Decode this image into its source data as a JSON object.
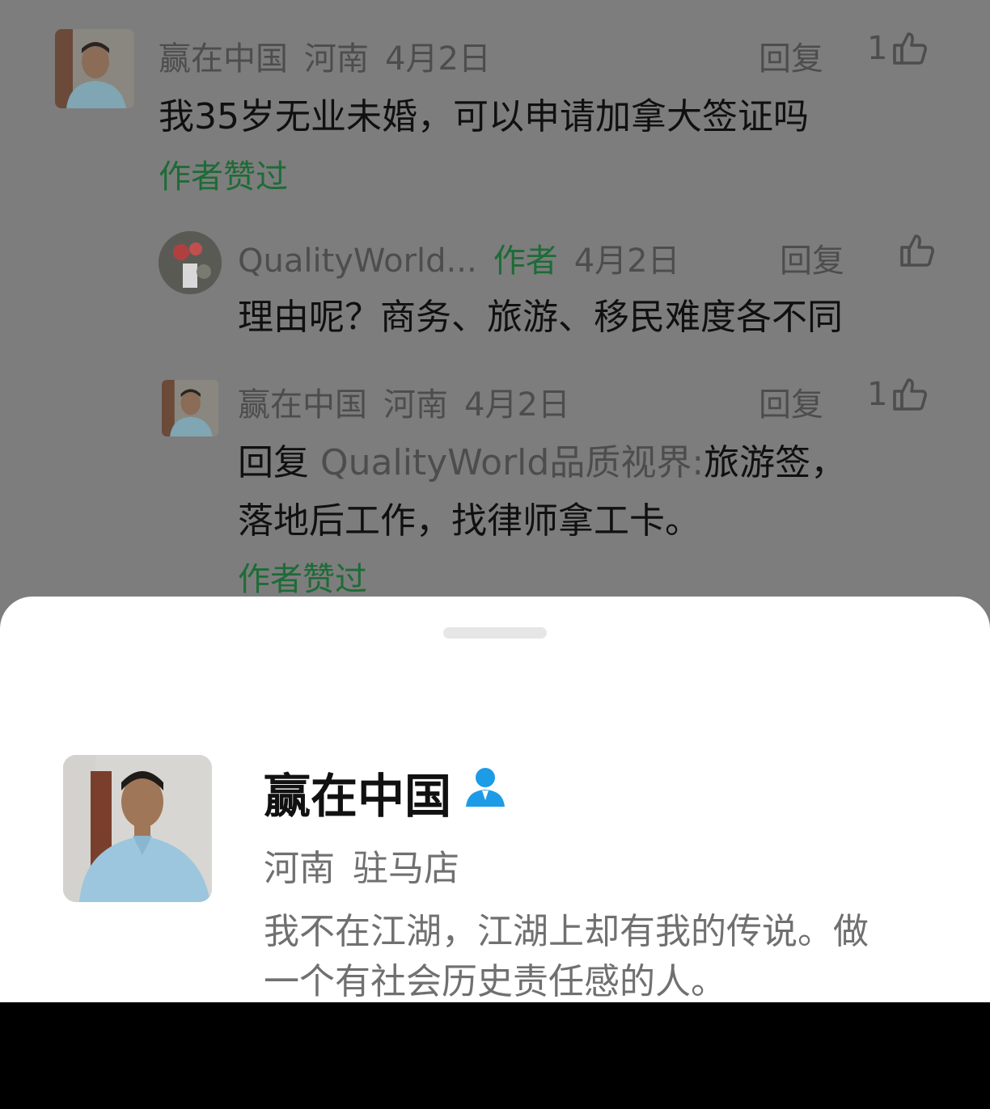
{
  "comments": [
    {
      "user": "赢在中国",
      "location": "河南",
      "date": "4月2日",
      "reply_label": "回复",
      "likes": "1",
      "text": "我35岁无业未婚，可以申请加拿大签证吗",
      "author_liked": "作者赞过"
    }
  ],
  "replies": [
    {
      "user": "QualityWorld...",
      "badge": "作者",
      "date": "4月2日",
      "reply_label": "回复",
      "text": "理由呢？商务、旅游、移民难度各不同"
    },
    {
      "user": "赢在中国",
      "location": "河南",
      "date": "4月2日",
      "reply_label": "回复",
      "likes": "1",
      "reply_prefix": "回复",
      "mention": "QualityWorld品质视界:",
      "text_line1": "旅游签，",
      "text_line2": "落地后工作，找律师拿工卡。",
      "author_liked": "作者赞过"
    }
  ],
  "profile": {
    "name": "赢在中国",
    "province": "河南",
    "city": "驻马店",
    "bio_line1": "我不在江湖，江湖上却有我的传说。做",
    "bio_line2": "一个有社会历史责任感的人。"
  },
  "icons": {
    "like": "thumbs-up-icon",
    "user_badge": "user-verified-icon"
  },
  "colors": {
    "overlay": "#7d7d7d",
    "author_green": "#1e6b37",
    "badge_blue": "#1e9be6"
  }
}
